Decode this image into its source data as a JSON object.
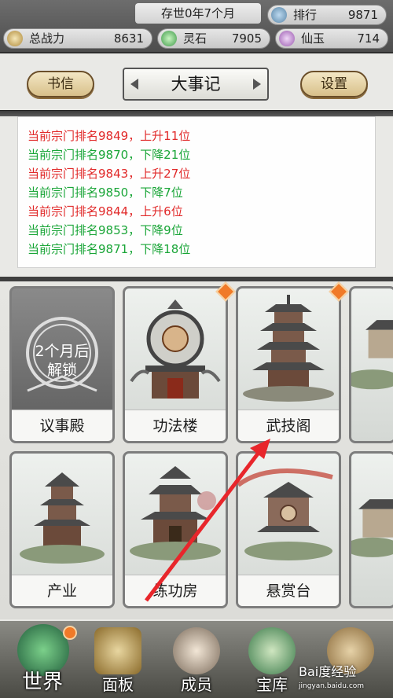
{
  "topbar": {
    "power_label": "总战力",
    "power_value": "8631",
    "era": "存世0年7个月",
    "rank_label": "排行",
    "rank_value": "9871",
    "stone_label": "灵石",
    "stone_value": "7905",
    "jade_label": "仙玉",
    "jade_value": "714"
  },
  "header": {
    "left_button": "书信",
    "title": "大事记",
    "right_button": "设置"
  },
  "news": [
    {
      "text": "当前宗门排名9849，上升11位",
      "dir": "up"
    },
    {
      "text": "当前宗门排名9870，下降21位",
      "dir": "down"
    },
    {
      "text": "当前宗门排名9843，上升27位",
      "dir": "up"
    },
    {
      "text": "当前宗门排名9850，下降7位",
      "dir": "down"
    },
    {
      "text": "当前宗门排名9844，上升6位",
      "dir": "up"
    },
    {
      "text": "当前宗门排名9853，下降9位",
      "dir": "down"
    },
    {
      "text": "当前宗门排名9871，下降18位",
      "dir": "down"
    }
  ],
  "buildings": [
    {
      "name": "议事殿",
      "locked_text": "2个月后",
      "locked_text2": "解锁"
    },
    {
      "name": "功法楼"
    },
    {
      "name": "武技阁"
    },
    {
      "name": "产业"
    },
    {
      "name": "练功房"
    },
    {
      "name": "悬赏台"
    }
  ],
  "nav": [
    {
      "label": "世界"
    },
    {
      "label": "面板"
    },
    {
      "label": "成员"
    },
    {
      "label": "宝库"
    }
  ],
  "watermark": {
    "main": "Bai度经验",
    "sub": "jingyan.baidu.com"
  },
  "colors": {
    "up": "#e12a2a",
    "down": "#19a537",
    "badge": "#f07a28"
  }
}
